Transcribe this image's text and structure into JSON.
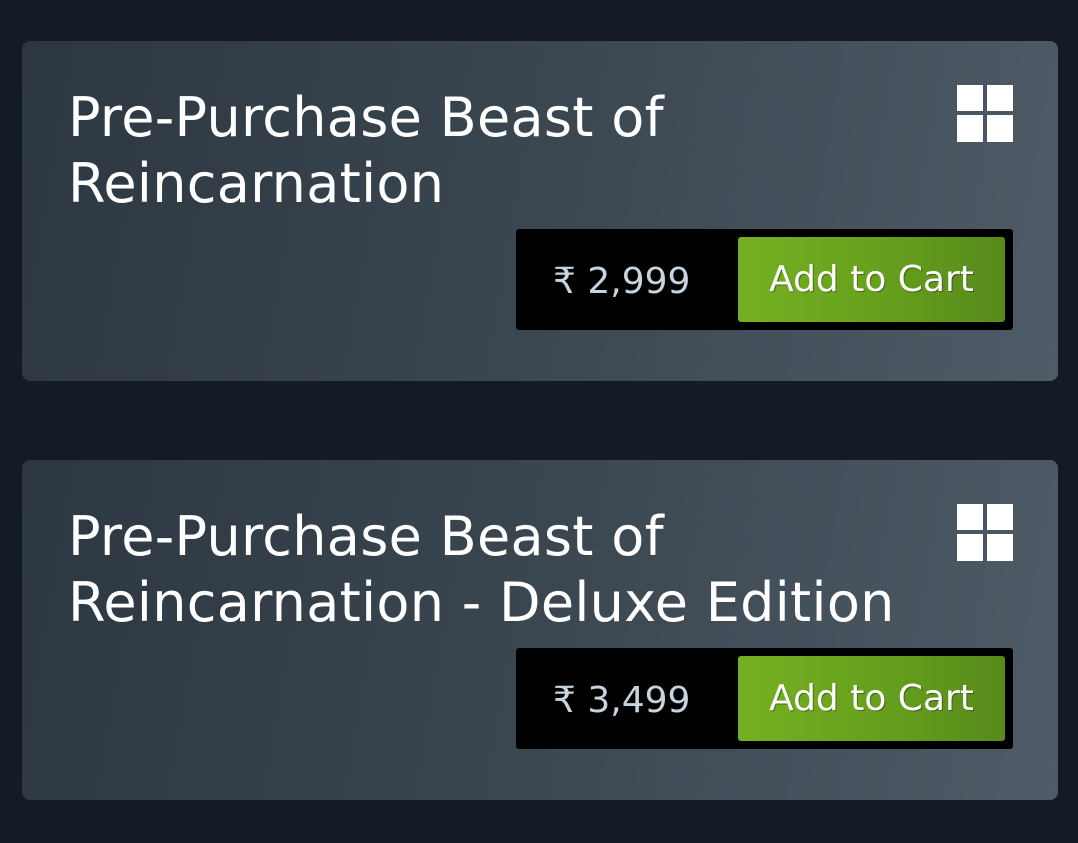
{
  "items": [
    {
      "title": "Pre-Purchase Beast of Reincarnation",
      "platform": "windows-icon",
      "price": "₹ 2,999",
      "button_label": "Add to Cart"
    },
    {
      "title": "Pre-Purchase Beast of Reincarnation - Deluxe Edition",
      "platform": "windows-icon",
      "price": "₹ 3,499",
      "button_label": "Add to Cart"
    }
  ],
  "colors": {
    "background": "#141b24",
    "button_accent": "#75b022",
    "price_text": "#c6d4df"
  }
}
